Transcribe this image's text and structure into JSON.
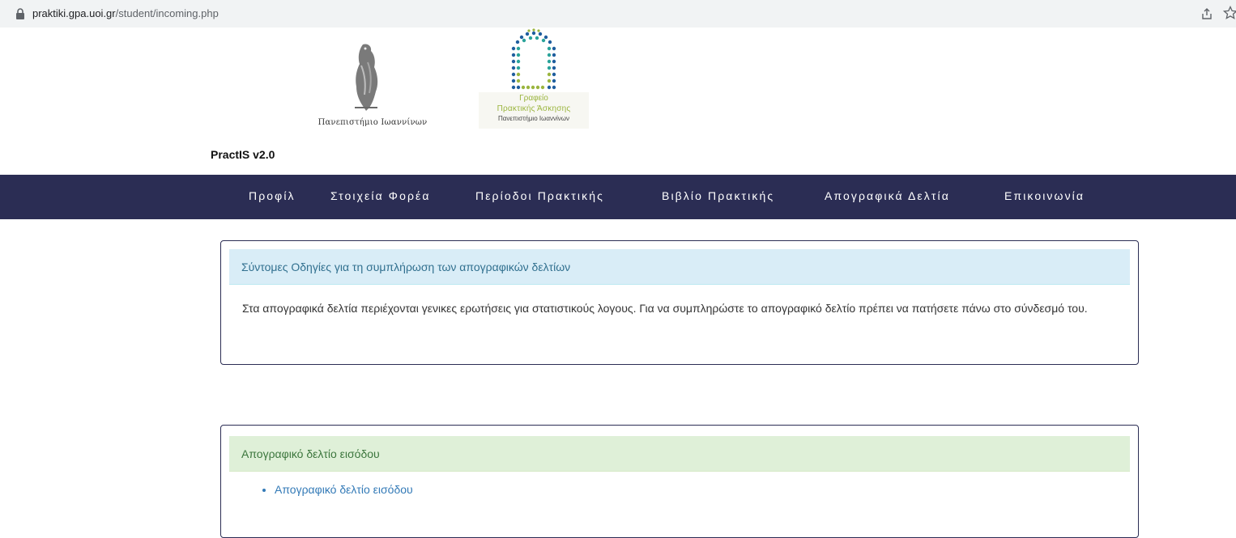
{
  "browser": {
    "url_domain": "praktiki.gpa.uoi.gr",
    "url_path": "/student/incoming.php"
  },
  "header": {
    "university_name": "Πανεπιστήμιο Ιωαννίνων",
    "office_logo_line1": "Γραφείο",
    "office_logo_line2": "Πρακτικής Άσκησης",
    "office_logo_line3": "Πανεπιστήμιο Ιωαννίνων",
    "app_title": "PractIS v2.0"
  },
  "nav": {
    "items": [
      {
        "label": "Προφίλ"
      },
      {
        "label": "Στοιχεία Φορέα"
      },
      {
        "label": "Περίοδοι Πρακτικής"
      },
      {
        "label": "Βιβλίο Πρακτικής"
      },
      {
        "label": "Απογραφικά Δελτία"
      },
      {
        "label": "Επικοινωνία"
      }
    ]
  },
  "instructions_panel": {
    "heading": "Σύντομες Οδηγίες για τη συμπλήρωση των απογραφικών δελτίων",
    "body": "Στα απογραφικά δελτία περιέχονται γενικες ερωτήσεις για στατιστικούς λογους. Για να συμπληρώστε το απογραφικό δελτίο πρέπει να πατήσετε πάνω στο σύνδεσμό του."
  },
  "incoming_panel": {
    "heading": "Απογραφικό δελτίο εισόδου",
    "links": [
      {
        "label": "Απογραφικό δελτίο εισόδου"
      }
    ]
  },
  "colors": {
    "navbar_bg": "#2b2d54",
    "info_heading_bg": "#d9edf7",
    "success_heading_bg": "#dff0d8",
    "link": "#337ab7"
  },
  "icons": [
    "lock-icon",
    "share-icon",
    "star-icon"
  ]
}
